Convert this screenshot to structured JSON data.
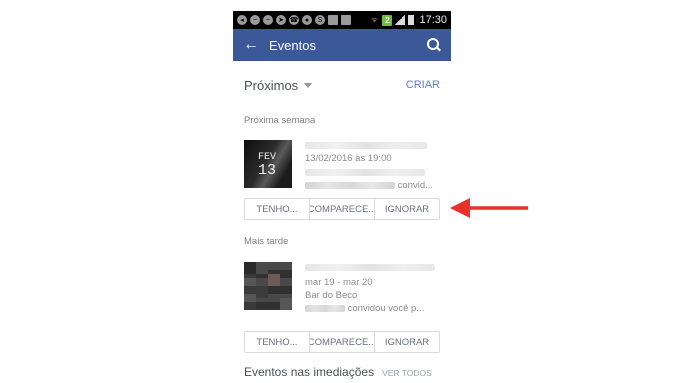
{
  "status_bar": {
    "time": "17:30",
    "badge": "2",
    "colors": {
      "background": "#000000",
      "badge": "#6fbf3f"
    }
  },
  "app_bar": {
    "title": "Eventos",
    "back_icon": "arrow-left-icon",
    "search_icon": "search-icon",
    "color": "#3b5998"
  },
  "filter": {
    "label": "Próximos",
    "create_label": "CRIAR",
    "accent": "#5b7bd5"
  },
  "sections": {
    "next_week": "Próxima semana",
    "later": "Mais tarde"
  },
  "events": [
    {
      "thumb_month": "FEV",
      "thumb_day": "13",
      "date": "13/02/2016 às 19:00",
      "location": "",
      "invite": "convid...",
      "actions": [
        "TENHO...",
        "COMPARECE...",
        "IGNORAR"
      ]
    },
    {
      "thumb_month": "",
      "thumb_day": "",
      "date": "mar 19 - mar 20",
      "location": "Bar do Beco",
      "invite": "convidou você p...",
      "actions": [
        "TENHO...",
        "COMPARECE...",
        "IGNORAR"
      ]
    }
  ],
  "nearby": {
    "title": "Eventos nas imediações",
    "link": "VER TODOS"
  },
  "annotation": {
    "arrow_color": "#e8312a"
  }
}
